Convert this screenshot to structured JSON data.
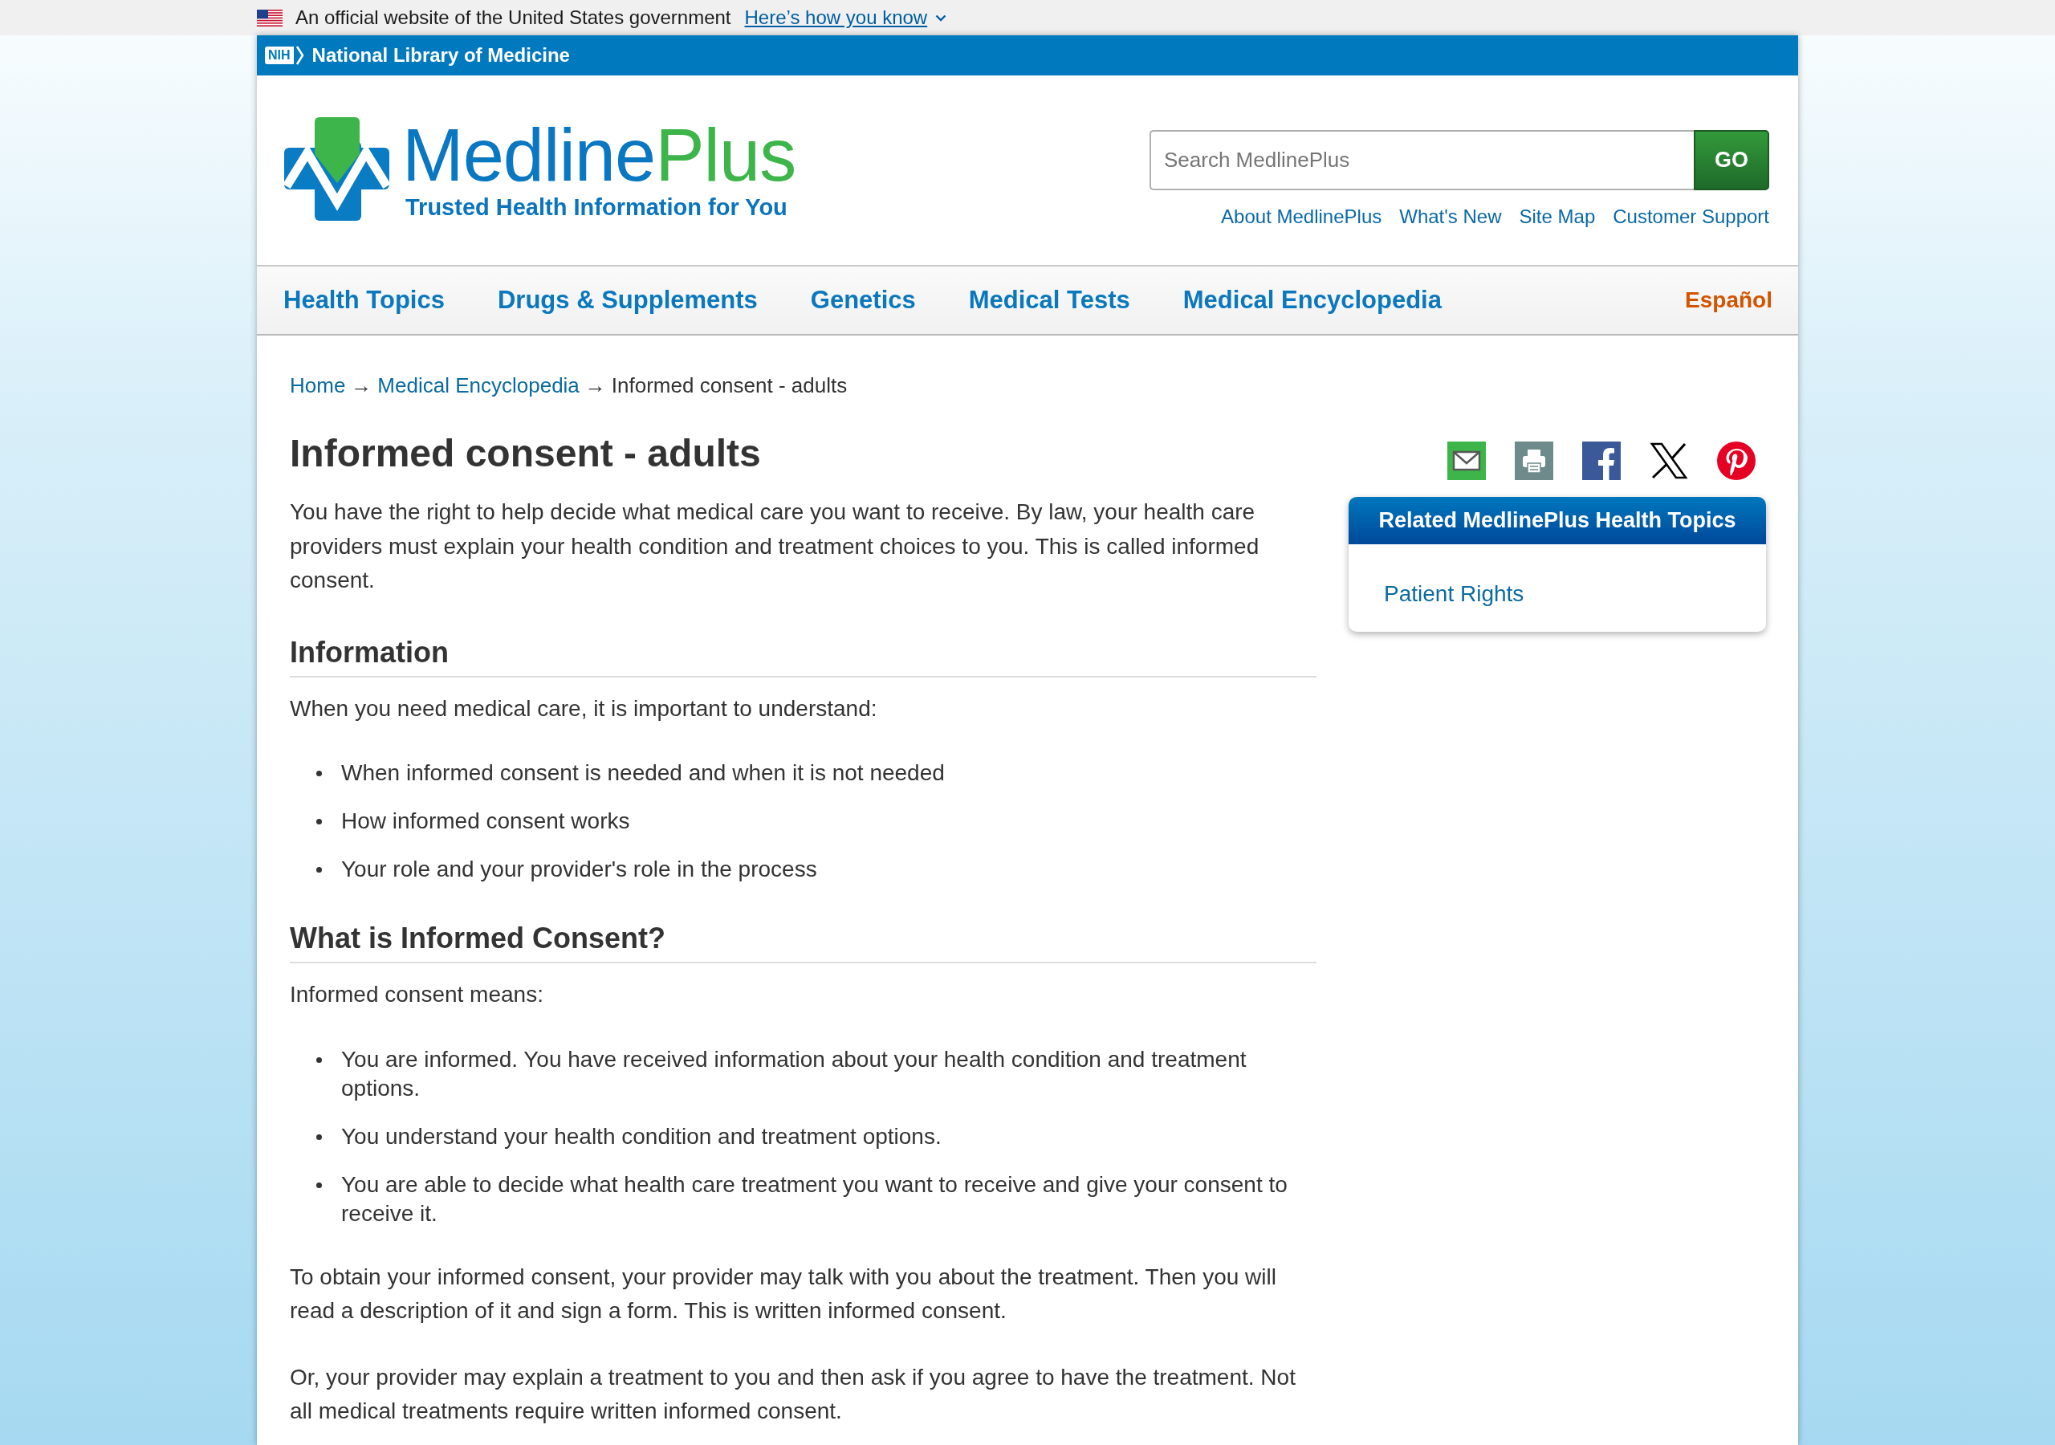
{
  "gov_banner": {
    "text": "An official website of the United States government",
    "link": "Here’s how you know"
  },
  "agency_bar": {
    "badge": "NIH",
    "title": "National Library of Medicine"
  },
  "header": {
    "logo": {
      "name_first": "Medline",
      "name_second": "Plus",
      "tagline": "Trusted Health Information for You"
    },
    "search": {
      "placeholder": "Search MedlinePlus",
      "button": "GO"
    },
    "links": [
      "About MedlinePlus",
      "What's New",
      "Site Map",
      "Customer Support"
    ]
  },
  "nav": {
    "items": [
      "Health Topics",
      "Drugs & Supplements",
      "Genetics",
      "Medical Tests",
      "Medical Encyclopedia"
    ],
    "language": "Español"
  },
  "breadcrumb": [
    {
      "label": "Home",
      "kind": "link"
    },
    {
      "separator": "→",
      "label": "Medical Encyclopedia",
      "kind": "link"
    },
    {
      "separator": "→",
      "label": "Informed consent - adults",
      "kind": "current"
    }
  ],
  "article": {
    "title": "Informed consent - adults",
    "sections": [
      {
        "blocks": [
          {
            "kind": "paragraph",
            "text": "You have the right to help decide what medical care you want to receive. By law, your health care providers must explain your health condition and treatment choices to you. This is called informed consent."
          }
        ]
      },
      {
        "heading": "Information",
        "blocks": [
          {
            "kind": "paragraph",
            "text": "When you need medical care, it is important to understand:"
          },
          {
            "kind": "list",
            "items": [
              "When informed consent is needed and when it is not needed",
              "How informed consent works",
              "Your role and your provider's role in the process"
            ]
          }
        ]
      },
      {
        "heading": "What is Informed Consent?",
        "blocks": [
          {
            "kind": "paragraph",
            "text": "Informed consent means:"
          },
          {
            "kind": "list",
            "items": [
              "You are informed. You have received information about your health condition and treatment options.",
              "You understand your health condition and treatment options.",
              "You are able to decide what health care treatment you want to receive and give your consent to receive it."
            ]
          },
          {
            "kind": "paragraph",
            "text": "To obtain your informed consent, your provider may talk with you about the treatment. Then you will read a description of it and sign a form. This is written informed consent."
          },
          {
            "kind": "paragraph",
            "text": "Or, your provider may explain a treatment to you and then ask if you agree to have the treatment. Not all medical treatments require written informed consent."
          }
        ]
      }
    ]
  },
  "sidebar": {
    "related": {
      "title": "Related MedlinePlus Health Topics",
      "links": [
        "Patient Rights"
      ]
    }
  }
}
